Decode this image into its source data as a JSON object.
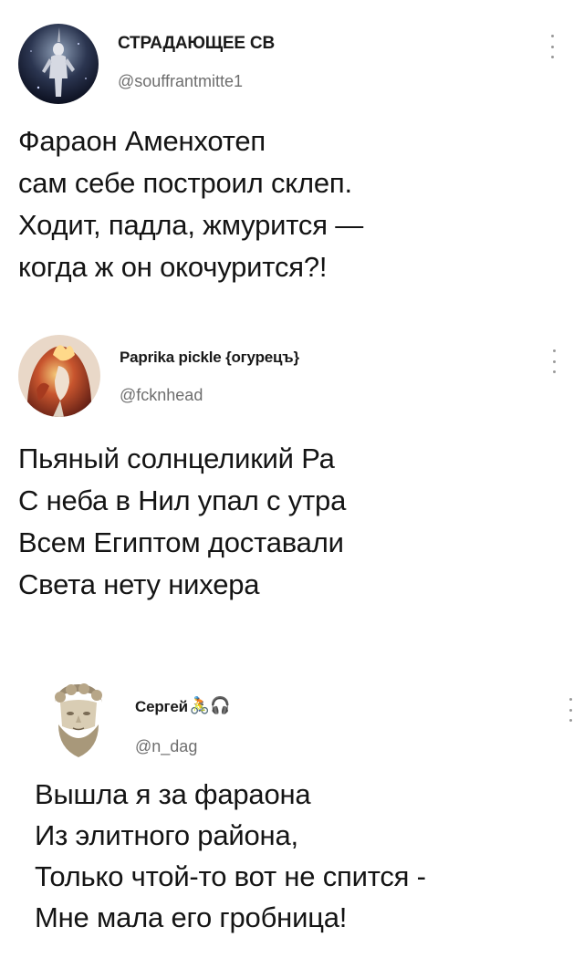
{
  "tweets": [
    {
      "author": "СТРАДАЮЩЕЕ СВ",
      "handle": "@souffrantmitte1",
      "avatar_icon": "statue-figure-avatar",
      "lines": [
        "Фараон Аменхотеп",
        "сам себе построил склеп.",
        "Ходит, падла, жмурится —",
        "когда ж он окочурится?!"
      ]
    },
    {
      "author": "Paprika pickle {огурецъ}",
      "handle": "@fcknhead",
      "avatar_icon": "fire-head-avatar",
      "lines": [
        "Пьяный солнцеликий Ра",
        "С неба в Нил упал с утра",
        "Всем Египтом доставали",
        "Света нету нихера"
      ]
    },
    {
      "author": "Сергей",
      "author_emojis": "🚴🎧",
      "handle": "@n_dag",
      "avatar_icon": "bust-sculpture-avatar",
      "lines": [
        "Вышла я за фараона",
        "Из элитного района,",
        "Только чтой-то вот не спится -",
        "Мне мала его гробница!"
      ]
    }
  ],
  "colors": {
    "text": "#141414",
    "handle": "#6e6e6e",
    "dots": "#9a9a9a"
  }
}
